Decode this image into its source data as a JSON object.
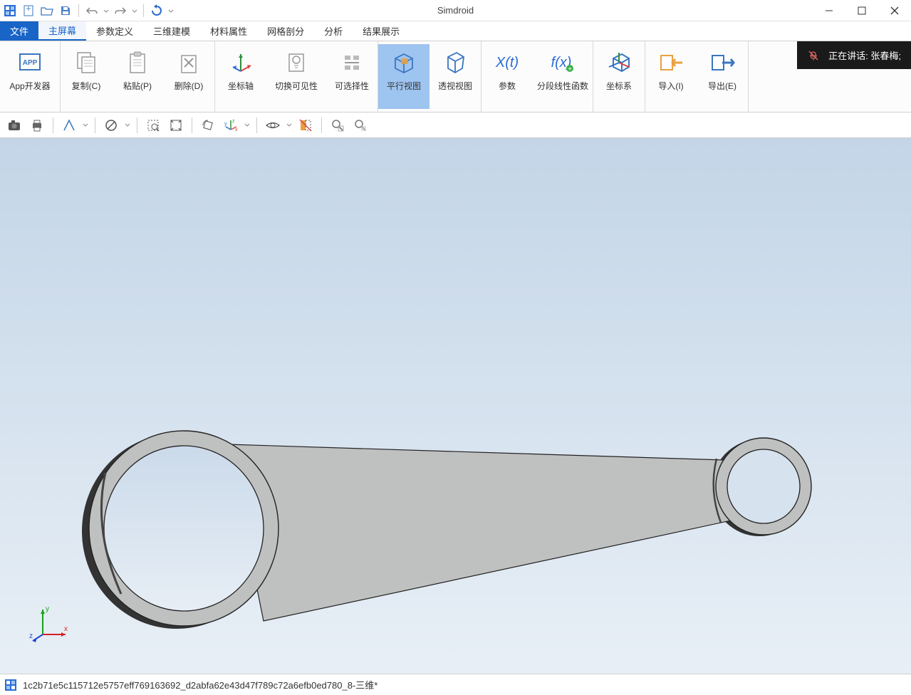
{
  "app_title": "Simdroid",
  "menubar": {
    "file": "文件",
    "tabs": [
      "主屏幕",
      "参数定义",
      "三维建模",
      "材料属性",
      "网格剖分",
      "分析",
      "结果展示"
    ],
    "active_index": 0
  },
  "notification": {
    "text": "正在讲话: 张春梅;"
  },
  "ribbon": {
    "app_developer": "App开发器",
    "copy": "复制(C)",
    "paste": "粘贴(P)",
    "delete": "删除(D)",
    "coord_axis": "坐标轴",
    "toggle_visibility": "切换可见性",
    "selectable": "可选择性",
    "parallel_view": "平行视图",
    "perspective_view": "透视视图",
    "parameters": "参数",
    "piecewise_linear_func": "分段线性函数",
    "coord_system": "坐标系",
    "import": "导入(I)",
    "export": "导出(E)"
  },
  "statusbar": {
    "text": "1c2b71e5c115712e5757eff769163692_d2abfa62e43d47f789c72a6efb0ed780_8-三维*"
  },
  "axes": {
    "x": "x",
    "y": "y",
    "z": "z"
  }
}
